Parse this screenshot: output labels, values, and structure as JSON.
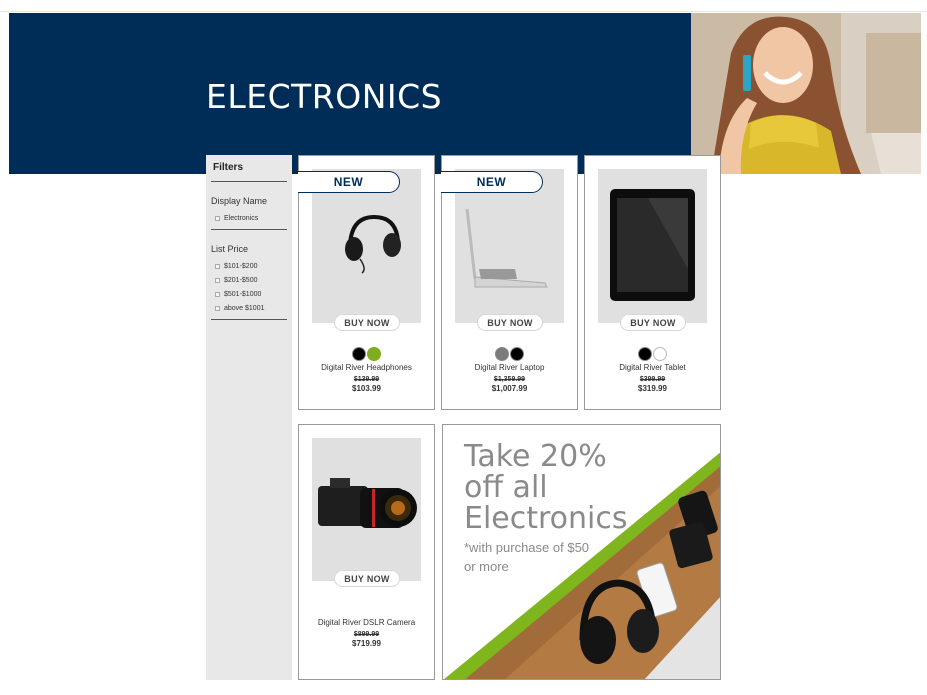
{
  "hero": {
    "title": "ELECTRONICS"
  },
  "filters": {
    "title": "Filters",
    "sections": [
      {
        "label": "Display Name",
        "options": [
          "Electronics"
        ]
      },
      {
        "label": "List Price",
        "options": [
          "$101-$200",
          "$201-$500",
          "$501-$1000",
          "above $1001"
        ]
      }
    ]
  },
  "products": [
    {
      "badge": "NEW",
      "buy_label": "BUY NOW",
      "swatches": [
        "#000000",
        "#7fad1f"
      ],
      "name": "Digital River Headphones",
      "old_price": "$139.99",
      "price": "$103.99",
      "icon": "headphones-icon"
    },
    {
      "badge": "NEW",
      "buy_label": "BUY NOW",
      "swatches": [
        "#7b7b7b",
        "#000000"
      ],
      "name": "Digital River Laptop",
      "old_price": "$1,359.99",
      "price": "$1,007.99",
      "icon": "laptop-icon"
    },
    {
      "badge": "",
      "buy_label": "BUY NOW",
      "swatches": [
        "#000000",
        "#ffffff"
      ],
      "name": "Digital River Tablet",
      "old_price": "$399.99",
      "price": "$319.99",
      "icon": "tablet-icon"
    },
    {
      "badge": "",
      "buy_label": "BUY NOW",
      "swatches": [],
      "name": "Digital River DSLR Camera",
      "old_price": "$899.99",
      "price": "$719.99",
      "icon": "camera-icon"
    }
  ],
  "promo": {
    "headline": "Take 20% off all Electronics",
    "subtext": "*with purchase of $50 or more",
    "accent_color": "#7fb51d"
  },
  "colors": {
    "brand_navy": "#002d57",
    "image_bg": "#e0e0e0"
  }
}
